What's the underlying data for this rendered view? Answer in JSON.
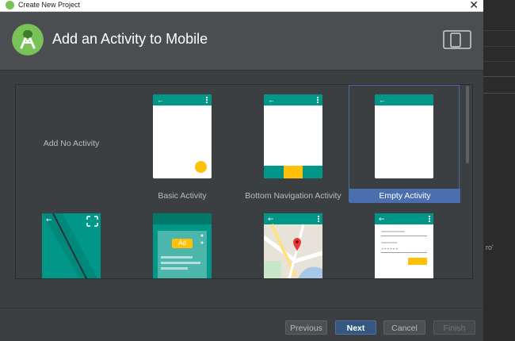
{
  "window": {
    "title": "Create New Project",
    "close_glyph": "✕"
  },
  "header": {
    "title": "Add an Activity to Mobile",
    "logo_icon": "android-studio-icon",
    "device_icon": "phone-tablet-icon"
  },
  "gallery": {
    "items": [
      {
        "label": "Add No Activity",
        "selected": false
      },
      {
        "label": "Basic Activity",
        "selected": false
      },
      {
        "label": "Bottom Navigation Activity",
        "selected": false
      },
      {
        "label": "Empty Activity",
        "selected": true
      }
    ],
    "lower_row_items": [
      {
        "template": "fullscreen-activity"
      },
      {
        "template": "google-admob-ads-activity",
        "badge": "Ad"
      },
      {
        "template": "google-maps-activity"
      },
      {
        "template": "login-activity"
      }
    ]
  },
  "footer": {
    "previous_label": "Previous",
    "next_label": "Next",
    "cancel_label": "Cancel",
    "finish_label": "Finish"
  },
  "background_ide": {
    "fragment_text": "ro'"
  },
  "colors": {
    "teal": "#009688",
    "amber": "#ffc107",
    "selection": "#4b6eaf",
    "android_green": "#78c257"
  }
}
